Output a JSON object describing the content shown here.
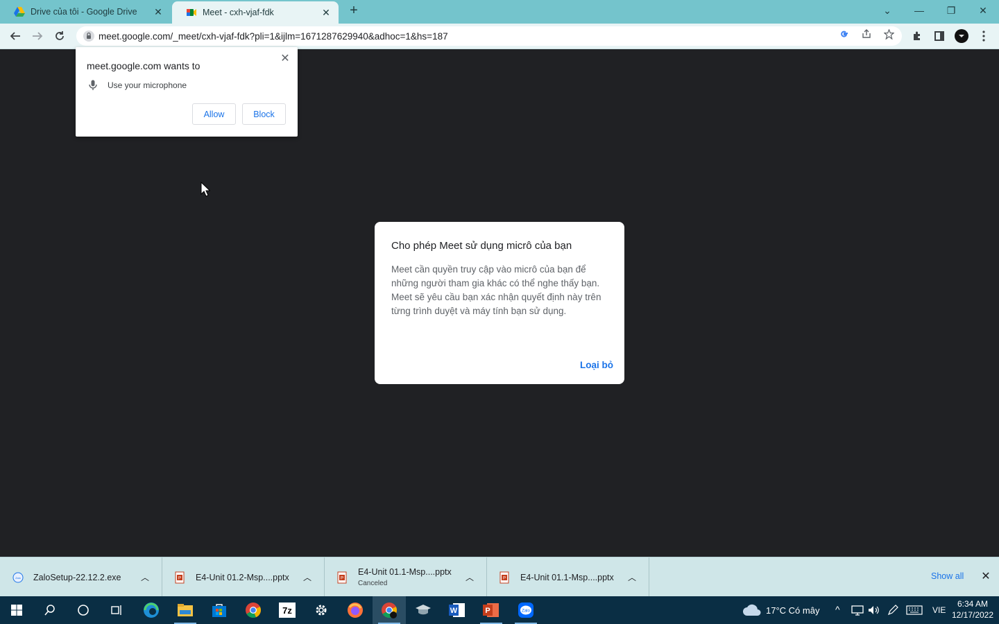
{
  "browser": {
    "tabs": [
      {
        "title": "Drive của tôi - Google Drive",
        "active": false
      },
      {
        "title": "Meet - cxh-vjaf-fdk",
        "active": true
      }
    ],
    "new_tab_label": "+",
    "url": "meet.google.com/_meet/cxh-vjaf-fdk?pli=1&ijlm=1671287629940&adhoc=1&hs=187"
  },
  "permission_prompt": {
    "title": "meet.google.com wants to",
    "request": "Use your microphone",
    "allow_label": "Allow",
    "block_label": "Block"
  },
  "meet_dialog": {
    "title": "Cho phép Meet sử dụng micrô của bạn",
    "body": "Meet cần quyền truy cập vào micrô của bạn để những người tham gia khác có thể nghe thấy bạn. Meet sẽ yêu cầu bạn xác nhận quyết định này trên từng trình duyệt và máy tính bạn sử dụng.",
    "dismiss_label": "Loại bỏ"
  },
  "downloads": {
    "items": [
      {
        "name": "ZaloSetup-22.12.2.exe",
        "status": "",
        "icon": "zalo-file-icon"
      },
      {
        "name": "E4-Unit 01.2-Msp....pptx",
        "status": "",
        "icon": "pptx-file-icon"
      },
      {
        "name": "E4-Unit 01.1-Msp....pptx",
        "status": "Canceled",
        "icon": "pptx-file-icon"
      },
      {
        "name": "E4-Unit 01.1-Msp....pptx",
        "status": "",
        "icon": "pptx-file-icon"
      }
    ],
    "show_all_label": "Show all"
  },
  "taskbar": {
    "weather": "17°C  Có mây",
    "language": "VIE",
    "time": "6:34 AM",
    "date": "12/17/2022"
  },
  "colors": {
    "tab_strip": "#74c4cc",
    "toolbar": "#e8f4f5",
    "page_bg": "#202124",
    "accent": "#1a73e8",
    "taskbar": "#0a2e44"
  }
}
